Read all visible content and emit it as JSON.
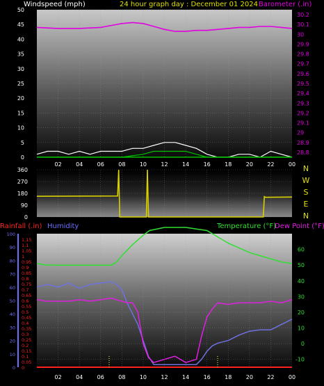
{
  "header": {
    "left": "Windspeed (mph)",
    "center": "24 hour graph day : December 01 2024",
    "right": "Barometer (.in)"
  },
  "compass_letters": [
    "N",
    "W",
    "S",
    "E",
    "N"
  ],
  "bottom_header": {
    "rainfall": "Rainfall (.in)",
    "humidity": "Humidity",
    "temperature": "Temperature (°F)",
    "dewpoint": "Dew Point (°F)"
  },
  "colors": {
    "windspeed": "#ffffff",
    "gust": "#00c000",
    "barometer": "#e000e0",
    "wind_dir": "#d8d000",
    "temperature": "#30e030",
    "dewpoint": "#e020e0",
    "humidity": "#7070e0",
    "rain": "#ff2020",
    "rain_axis": "#7070ff",
    "center_title": "#e0e000"
  },
  "chart_data": [
    {
      "type": "line",
      "name": "wind-barometer",
      "x_tick_labels": [
        "02",
        "04",
        "06",
        "08",
        "10",
        "12",
        "14",
        "16",
        "18",
        "20",
        "22",
        "00"
      ],
      "y_left": {
        "ticks": [
          0,
          5,
          10,
          15,
          20,
          25,
          30,
          35,
          40,
          45,
          50
        ],
        "ylim": [
          0,
          50
        ]
      },
      "y_right": {
        "ticks": [
          28.8,
          28.9,
          29,
          29.1,
          29.2,
          29.3,
          29.4,
          29.5,
          29.6,
          29.7,
          29.8,
          29.9,
          30,
          30.1,
          30.2
        ],
        "tick_labels": [
          "28.8",
          "28.9",
          "29",
          "29.1",
          "29.2",
          "29.3",
          "29.4",
          "29.5",
          "29.6",
          "29.7",
          "29.8",
          "29.9",
          "30",
          "30.1",
          "30.2"
        ],
        "ylim": [
          28.75,
          30.25
        ]
      },
      "barometer": {
        "x": [
          0,
          2,
          4,
          6,
          7,
          8,
          9,
          10,
          11,
          12,
          13,
          14,
          15,
          16,
          17,
          18,
          19,
          20,
          21,
          22,
          23,
          24
        ],
        "y": [
          30.07,
          30.06,
          30.06,
          30.07,
          30.09,
          30.11,
          30.12,
          30.11,
          30.08,
          30.05,
          30.03,
          30.03,
          30.04,
          30.04,
          30.05,
          30.06,
          30.07,
          30.07,
          30.08,
          30.08,
          30.07,
          30.06
        ]
      },
      "windspeed": {
        "x": [
          0,
          1,
          2,
          3,
          4,
          5,
          6,
          7,
          8,
          9,
          10,
          11,
          12,
          13,
          14,
          15,
          16,
          17,
          18,
          19,
          20,
          21,
          22,
          23,
          24
        ],
        "y": [
          1,
          2,
          2,
          1,
          2,
          1,
          2,
          2,
          2,
          3,
          3,
          4,
          5,
          5,
          4,
          3,
          1,
          0,
          0,
          1,
          1,
          0,
          2,
          1,
          0
        ]
      },
      "gust": {
        "x": [
          0,
          2,
          4,
          6,
          8,
          9,
          10,
          11,
          12,
          13,
          14,
          15,
          16,
          18,
          20,
          22,
          24
        ],
        "y": [
          0,
          0,
          0,
          0,
          0,
          0.5,
          1,
          2,
          2,
          2,
          2,
          1,
          0,
          0,
          0,
          0,
          0
        ]
      }
    },
    {
      "type": "line",
      "name": "wind-direction",
      "y_ticks": [
        0,
        90,
        180,
        270,
        360
      ],
      "ylim": [
        0,
        360
      ],
      "x": [
        0,
        7.6,
        7.7,
        7.8,
        10.3,
        10.4,
        10.5,
        21.3,
        21.4,
        21.5,
        24
      ],
      "y": [
        158,
        160,
        360,
        0,
        0,
        360,
        0,
        0,
        155,
        150,
        152
      ]
    },
    {
      "type": "line",
      "name": "temp-humidity-rain",
      "x_tick_labels": [
        "02",
        "04",
        "06",
        "08",
        "10",
        "12",
        "14",
        "16",
        "18",
        "20",
        "22",
        "00"
      ],
      "y_left": {
        "ticks": [
          0,
          0.05,
          0.1,
          0.15,
          0.2,
          0.25,
          0.3,
          0.35,
          0.4,
          0.45,
          0.5,
          0.55,
          0.6,
          0.65,
          0.7,
          0.75,
          0.8,
          0.85,
          0.9,
          0.95,
          1,
          1.05,
          1.1,
          1.15
        ],
        "tick_labels": [
          "0",
          "0.05",
          "0.1",
          "0.15",
          "0.2",
          "0.25",
          "0.3",
          "0.35",
          "0.4",
          "0.45",
          "0.5",
          "0.55",
          "0.6",
          "0.65",
          "0.7",
          "0.75",
          "0.8",
          "0.85",
          "0.9",
          "0.95",
          "1",
          "1.05",
          "1.1",
          "1.15"
        ],
        "ylim": [
          0,
          1.2
        ]
      },
      "y_humidity": {
        "ticks": [
          0,
          10,
          20,
          30,
          40,
          50,
          60,
          70,
          80,
          90,
          100
        ],
        "ylim": [
          0,
          100
        ]
      },
      "y_right": {
        "ticks": [
          -10,
          0,
          10,
          20,
          30,
          40,
          50,
          60
        ],
        "ylim": [
          -15,
          70
        ]
      },
      "temperature": {
        "x": [
          0,
          1,
          2,
          4,
          6,
          7,
          7.5,
          8,
          9,
          10,
          10.6,
          12,
          14,
          16,
          17,
          18,
          19,
          20,
          21,
          22,
          23,
          24
        ],
        "y": [
          51,
          50,
          50,
          50,
          50,
          50,
          52,
          56,
          63,
          69,
          72,
          74,
          74,
          72,
          68,
          64,
          61,
          58,
          56,
          54,
          52,
          51
        ]
      },
      "dewpoint": {
        "x": [
          0,
          1,
          2,
          3,
          4,
          5,
          6,
          7,
          8,
          8.5,
          9,
          9.5,
          10,
          10.5,
          11,
          12,
          13,
          14,
          15,
          15.5,
          16,
          16.5,
          17,
          18,
          19,
          20,
          21,
          22,
          23,
          24
        ],
        "y": [
          28,
          27,
          27,
          27,
          28,
          27,
          28,
          29,
          27,
          26,
          26,
          20,
          0,
          -9,
          -12,
          -10,
          -8,
          -12,
          -10,
          5,
          17,
          22,
          26,
          25,
          26,
          26,
          26,
          27,
          26,
          28
        ]
      },
      "humidity": {
        "x": [
          0,
          1,
          2,
          3,
          4,
          5,
          6,
          7,
          7.5,
          8,
          8.5,
          9,
          9.5,
          10,
          10.5,
          11,
          12,
          13,
          14,
          15,
          15.5,
          16,
          16.5,
          17,
          18,
          19,
          20,
          21,
          22,
          23,
          24
        ],
        "y": [
          60,
          62,
          60,
          63,
          59,
          62,
          63,
          64,
          62,
          58,
          48,
          40,
          32,
          20,
          8,
          2,
          2,
          2,
          2,
          2,
          6,
          12,
          16,
          18,
          20,
          24,
          27,
          28,
          28,
          32,
          36
        ]
      },
      "rain": {
        "x": [
          0,
          24
        ],
        "y": [
          0,
          0
        ]
      }
    }
  ]
}
